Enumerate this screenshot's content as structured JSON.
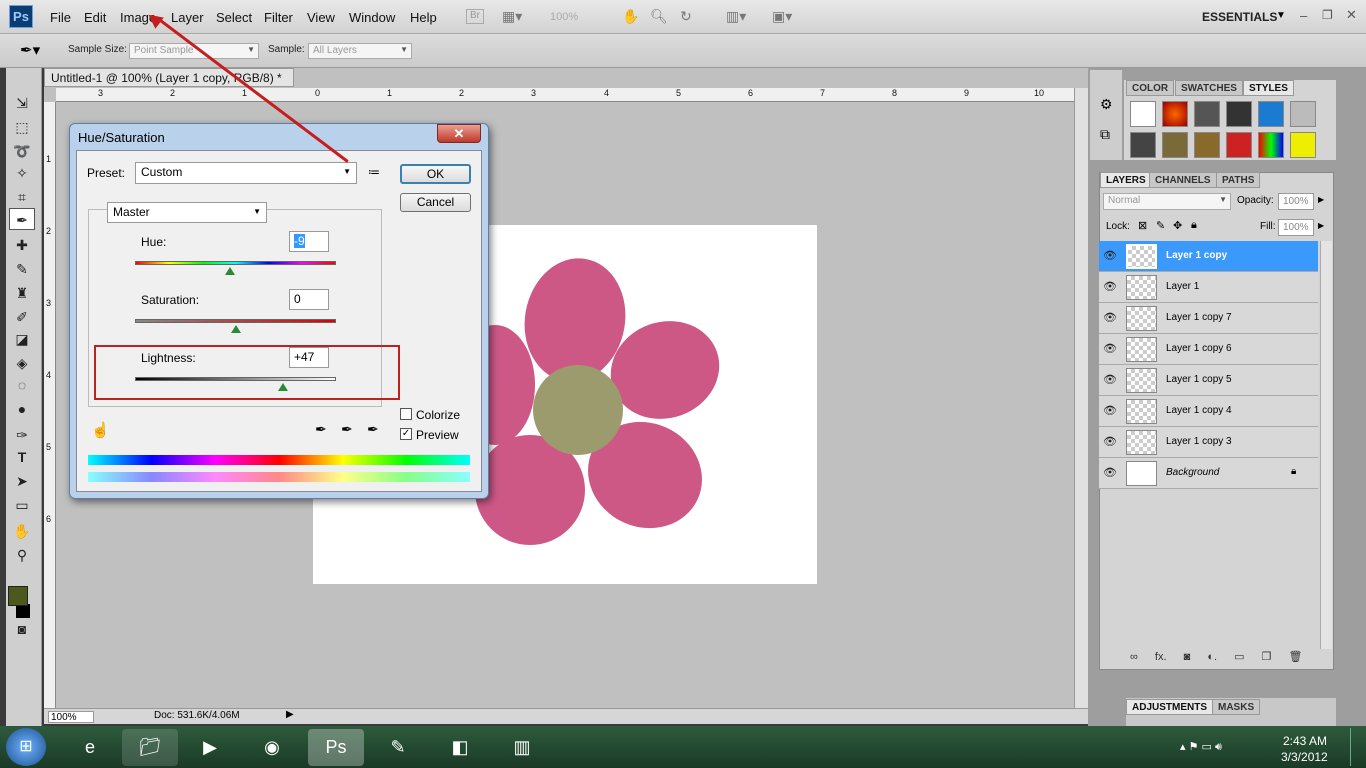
{
  "app": {
    "logo": "Ps",
    "workspace": "ESSENTIALS"
  },
  "menu": [
    "File",
    "Edit",
    "Image",
    "Layer",
    "Select",
    "Filter",
    "View",
    "Window",
    "Help"
  ],
  "menubar_extras": {
    "bridge": "Br",
    "zoom": "100%"
  },
  "options": {
    "sample_size_label": "Sample Size:",
    "sample_size_value": "Point Sample",
    "sample_label": "Sample:",
    "sample_value": "All Layers"
  },
  "document": {
    "tab_title": "Untitled-1 @ 100% (Layer 1 copy, RGB/8) *",
    "ruler_h": [
      "3",
      "2",
      "1",
      "0",
      "1",
      "2",
      "3",
      "4",
      "5",
      "6",
      "7",
      "8",
      "9",
      "10"
    ],
    "ruler_v": [
      "1",
      "2",
      "3",
      "4",
      "5",
      "6"
    ],
    "status_zoom": "100%",
    "status_doc": "Doc: 531.6K/4.06M"
  },
  "dialog": {
    "title": "Hue/Saturation",
    "preset_label": "Preset:",
    "preset_value": "Custom",
    "channel_value": "Master",
    "hue_label": "Hue:",
    "hue_value": "-9",
    "saturation_label": "Saturation:",
    "saturation_value": "0",
    "lightness_label": "Lightness:",
    "lightness_value": "+47",
    "ok_label": "OK",
    "cancel_label": "Cancel",
    "colorize_label": "Colorize",
    "preview_label": "Preview",
    "colorize_checked": false,
    "preview_checked": true,
    "hue_slider_fraction": 0.475,
    "saturation_slider_fraction": 0.5,
    "lightness_slider_fraction": 0.735
  },
  "panels": {
    "top_tabs": [
      "COLOR",
      "SWATCHES",
      "STYLES"
    ],
    "layers_tabs": [
      "LAYERS",
      "CHANNELS",
      "PATHS"
    ],
    "blend_mode": "Normal",
    "opacity_label": "Opacity:",
    "opacity_value": "100%",
    "lock_label": "Lock:",
    "fill_label": "Fill:",
    "fill_value": "100%",
    "layers": [
      "Layer 1 copy",
      "Layer 1",
      "Layer 1 copy 7",
      "Layer 1 copy 6",
      "Layer 1 copy 5",
      "Layer 1 copy 4",
      "Layer 1 copy 3",
      "Background"
    ],
    "bottom_tabs": [
      "ADJUSTMENTS",
      "MASKS"
    ]
  },
  "taskbar": {
    "time": "2:43 AM",
    "date": "3/3/2012"
  },
  "colors": {
    "accent_selected": "#3b99fc",
    "annotation_red": "#c41e1e",
    "flower_pink": "#c8467a",
    "flower_center": "#9b9b6e",
    "foreground_color": "#4b5a1c"
  }
}
